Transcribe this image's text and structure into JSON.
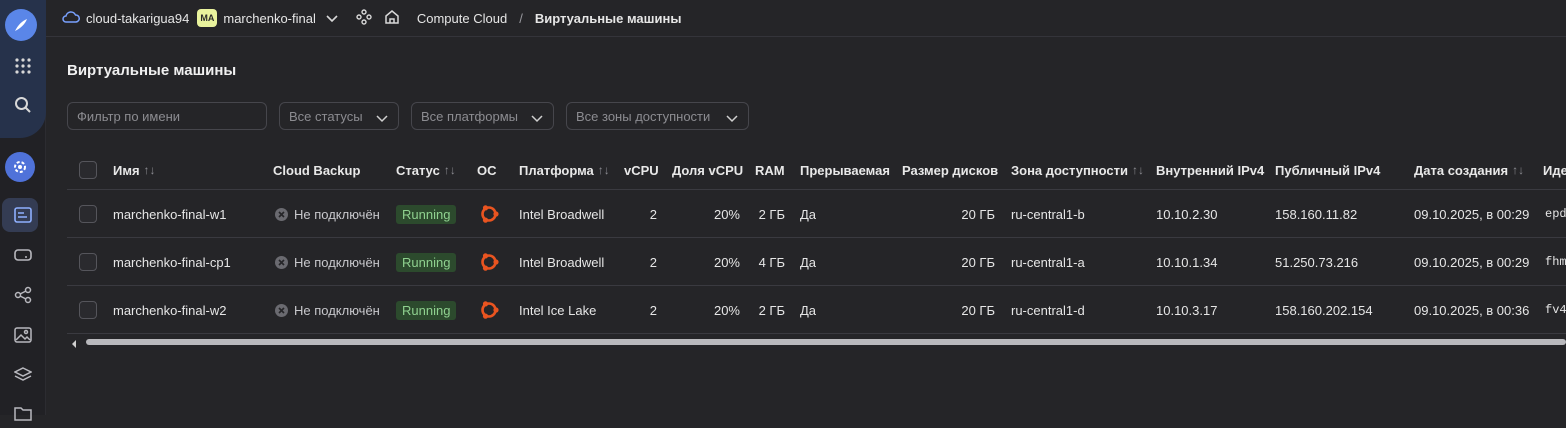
{
  "header": {
    "cloud": "cloud-takarigua94",
    "folder_badge": "MA",
    "folder": "marchenko-final",
    "service": "Compute Cloud",
    "separator": "/",
    "current": "Виртуальные машины"
  },
  "page": {
    "title": "Виртуальные машины"
  },
  "filters": {
    "name_placeholder": "Фильтр по имени",
    "status": "Все статусы",
    "platform": "Все платформы",
    "zone": "Все зоны доступности"
  },
  "table": {
    "columns": {
      "name": "Имя",
      "backup": "Cloud Backup",
      "status": "Статус",
      "os": "ОС",
      "platform": "Платформа",
      "vcpu": "vCPU",
      "share": "Доля vCPU",
      "ram": "RAM",
      "preempt": "Прерываемая",
      "disk": "Размер дисков",
      "zone": "Зона доступности",
      "internal": "Внутренний IPv4",
      "public": "Публичный IPv4",
      "created": "Дата создания",
      "id": "Иде"
    },
    "rows": [
      {
        "name": "marchenko-final-w1",
        "backup": "Не подключён",
        "status": "Running",
        "platform": "Intel Broadwell",
        "vcpu": "2",
        "share": "20%",
        "ram": "2 ГБ",
        "preempt": "Да",
        "disk": "20 ГБ",
        "zone": "ru-central1-b",
        "internal": "10.10.2.30",
        "public": "158.160.11.82",
        "created": "09.10.2025, в 00:29",
        "id": "epd"
      },
      {
        "name": "marchenko-final-cp1",
        "backup": "Не подключён",
        "status": "Running",
        "platform": "Intel Broadwell",
        "vcpu": "2",
        "share": "20%",
        "ram": "4 ГБ",
        "preempt": "Да",
        "disk": "20 ГБ",
        "zone": "ru-central1-a",
        "internal": "10.10.1.34",
        "public": "51.250.73.216",
        "created": "09.10.2025, в 00:29",
        "id": "fhm"
      },
      {
        "name": "marchenko-final-w2",
        "backup": "Не подключён",
        "status": "Running",
        "platform": "Intel Ice Lake",
        "vcpu": "2",
        "share": "20%",
        "ram": "2 ГБ",
        "preempt": "Да",
        "disk": "20 ГБ",
        "zone": "ru-central1-d",
        "internal": "10.10.3.17",
        "public": "158.160.202.154",
        "created": "09.10.2025, в 00:36",
        "id": "fv4"
      }
    ]
  },
  "colors": {
    "accent": "#4f72d9",
    "running_bg": "#2c4a2d",
    "running_text": "#8fd18f",
    "ubuntu": "#e95420"
  }
}
